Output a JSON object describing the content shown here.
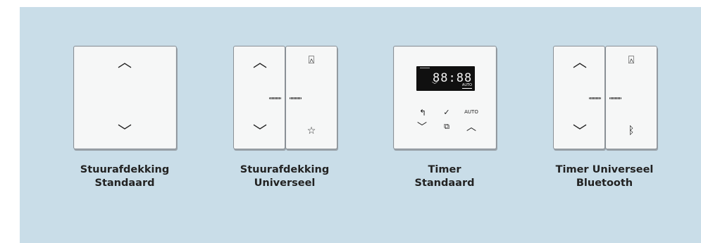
{
  "products": [
    {
      "caption_line1": "Stuurafdekking",
      "caption_line2": "Standaard",
      "buttons": {
        "up": "︿",
        "down": "﹀"
      }
    },
    {
      "caption_line1": "Stuurafdekking",
      "caption_line2": "Universeel",
      "buttons": {
        "up": "︿",
        "down": "﹀",
        "lock": "⍓",
        "star": "☆"
      }
    },
    {
      "caption_line1": "Timer",
      "caption_line2": "Standaard",
      "display": {
        "time": "88:88",
        "mode": "AUTO"
      },
      "buttons": {
        "back": "↰",
        "confirm": "✓",
        "auto": "AUTO",
        "down": "﹀",
        "copy": "⧉",
        "up": "︿"
      }
    },
    {
      "caption_line1": "Timer Universeel",
      "caption_line2": "Bluetooth",
      "buttons": {
        "up": "︿",
        "down": "﹀",
        "lock": "⍓",
        "bluetooth": "ᛒ"
      }
    }
  ],
  "colors": {
    "background": "#c9dde8",
    "plate": "#f6f7f7",
    "border": "#8a9096",
    "text": "#222222"
  }
}
